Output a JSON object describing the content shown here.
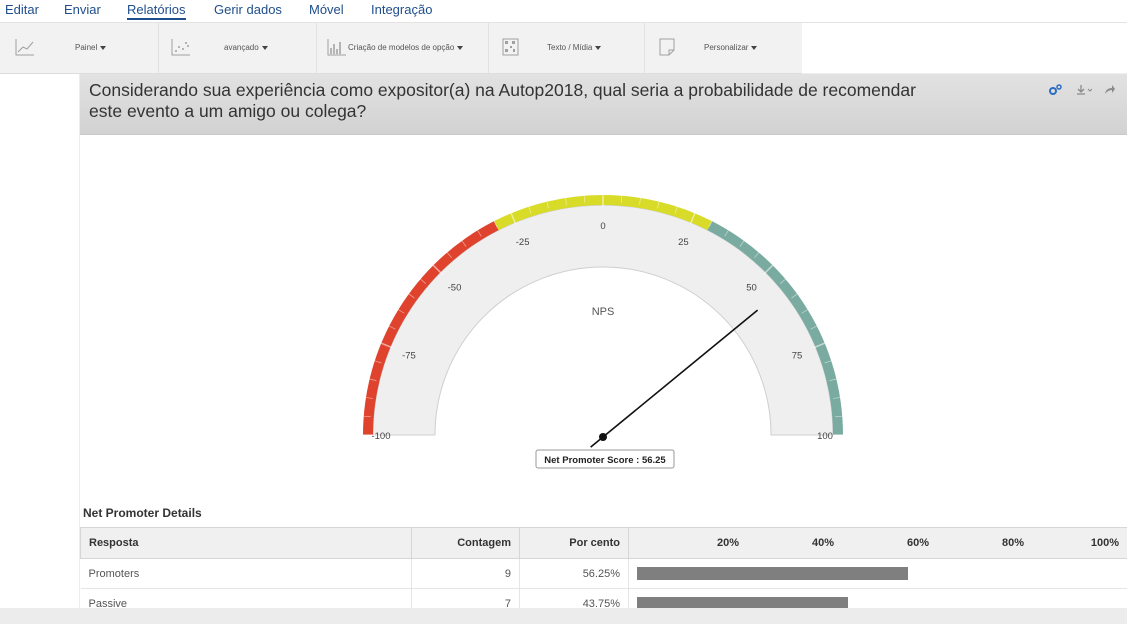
{
  "menu": {
    "items": [
      {
        "label": "Editar",
        "active": false
      },
      {
        "label": "Enviar",
        "active": false
      },
      {
        "label": "Relatórios",
        "active": true
      },
      {
        "label": "Gerir dados",
        "active": false
      },
      {
        "label": "Móvel",
        "active": false
      },
      {
        "label": "Integração",
        "active": false
      }
    ]
  },
  "toolbar": {
    "groups": [
      {
        "label": "Painel",
        "icon": "line-chart-icon"
      },
      {
        "label": "avançado",
        "icon": "scatter-chart-icon"
      },
      {
        "label": "Criação de modelos de opção",
        "icon": "bar-chart-icon"
      },
      {
        "label": "Texto / Mídia",
        "icon": "qr-code-icon"
      },
      {
        "label": "Personalizar",
        "icon": "document-icon"
      }
    ]
  },
  "question": {
    "title": "Considerando sua experiência como expositor(a) na Autop2018, qual seria a probabilidade de recomendar este evento a um amigo ou colega?",
    "icons": [
      "settings-icon",
      "download-icon",
      "share-icon"
    ]
  },
  "gauge": {
    "label": "NPS",
    "min": -100,
    "max": 100,
    "value": 56.25,
    "tick_labels": [
      "-100",
      "-75",
      "-50",
      "-25",
      "0",
      "25",
      "50",
      "75",
      "100"
    ],
    "tooltip": "Net Promoter Score : 56.25",
    "bands": [
      {
        "from": -100,
        "to": -30,
        "color": "#e0432d"
      },
      {
        "from": -30,
        "to": 30,
        "color": "#d8dc28"
      },
      {
        "from": 30,
        "to": 100,
        "color": "#7aaba1"
      }
    ]
  },
  "details": {
    "title": "Net Promoter Details",
    "headers": {
      "response": "Resposta",
      "count": "Contagem",
      "percent": "Por cento"
    },
    "scale": [
      "20%",
      "40%",
      "60%",
      "80%",
      "100%"
    ],
    "rows": [
      {
        "response": "Promoters",
        "count": "9",
        "percent": "56.25%",
        "value": 56.25
      },
      {
        "response": "Passive",
        "count": "7",
        "percent": "43.75%",
        "value": 43.75
      }
    ]
  }
}
